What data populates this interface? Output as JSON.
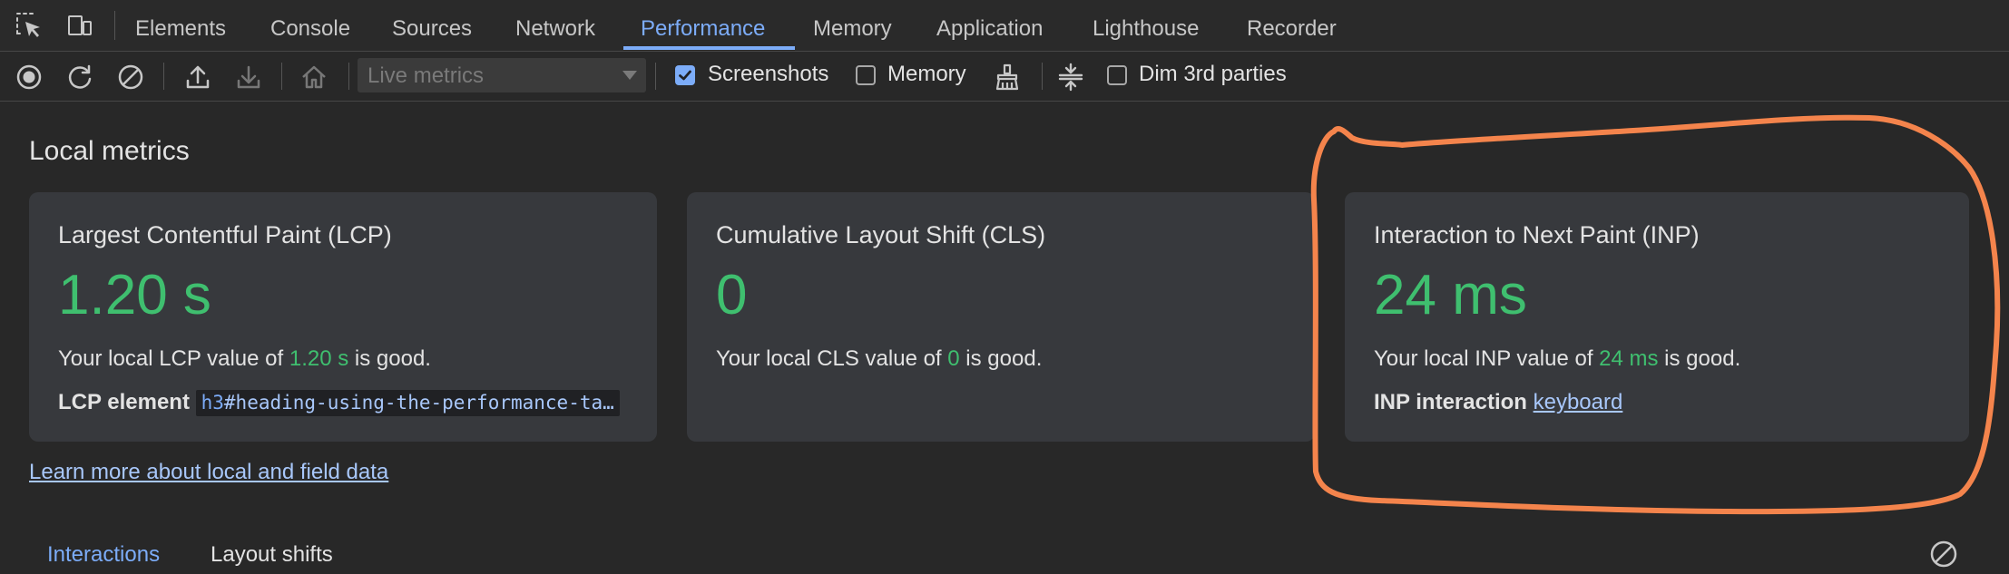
{
  "tabbar": {
    "tabs": [
      {
        "label": "Elements"
      },
      {
        "label": "Console"
      },
      {
        "label": "Sources"
      },
      {
        "label": "Network"
      },
      {
        "label": "Performance",
        "active": true
      },
      {
        "label": "Memory"
      },
      {
        "label": "Application"
      },
      {
        "label": "Lighthouse"
      },
      {
        "label": "Recorder"
      }
    ],
    "icons": [
      "select-element-icon",
      "device-toolbar-icon"
    ]
  },
  "toolbar": {
    "icons": [
      "record-icon",
      "reload-icon",
      "clear-icon",
      "upload-icon",
      "download-icon",
      "home-icon"
    ],
    "dropdown_value": "Live metrics",
    "screenshots_label": "Screenshots",
    "screenshots_checked": true,
    "memory_label": "Memory",
    "memory_checked": false,
    "gc_icon": "collect-garbage-icon",
    "collapse_icon": "collapse-icon",
    "dim_label": "Dim 3rd parties",
    "dim_checked": false
  },
  "main": {
    "title": "Local metrics",
    "cards": {
      "lcp": {
        "title": "Largest Contentful Paint (LCP)",
        "value": "1.20 s",
        "desc_prefix": "Your local LCP value of ",
        "desc_value": "1.20 s",
        "desc_suffix": " is good.",
        "detail_label": "LCP element",
        "element_tag": "h3",
        "element_rest": "#heading-using-the-performance-ta…"
      },
      "cls": {
        "title": "Cumulative Layout Shift (CLS)",
        "value": "0",
        "desc_prefix": "Your local CLS value of ",
        "desc_value": "0",
        "desc_suffix": " is good."
      },
      "inp": {
        "title": "Interaction to Next Paint (INP)",
        "value": "24 ms",
        "desc_prefix": "Your local INP value of ",
        "desc_value": "24 ms",
        "desc_suffix": " is good.",
        "detail_label": "INP interaction",
        "detail_link": "keyboard"
      }
    },
    "learn_more": "Learn more about local and field data",
    "subtabs": [
      {
        "label": "Interactions",
        "active": true
      },
      {
        "label": "Layout shifts",
        "active": false
      }
    ]
  },
  "colors": {
    "good": "#3fbf6f",
    "accent": "#7cacf8",
    "annotation": "#f4844c"
  }
}
